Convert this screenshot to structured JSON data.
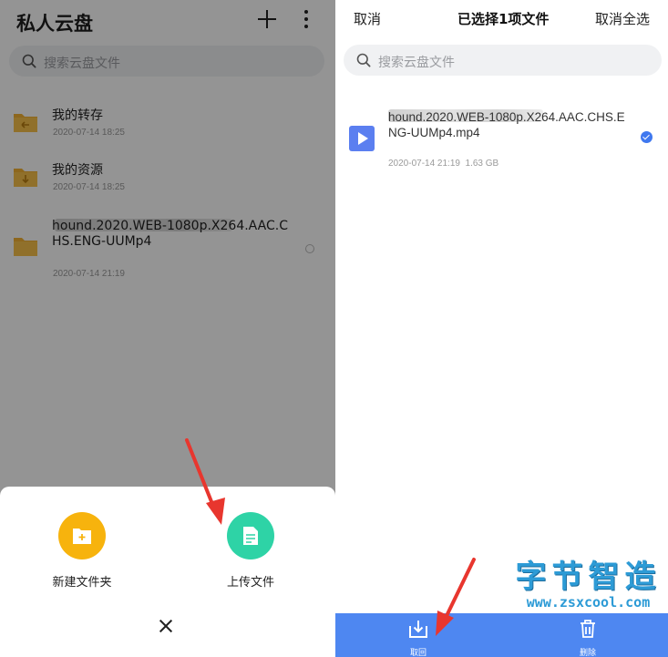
{
  "left": {
    "title": "私人云盘",
    "search_placeholder": "搜索云盘文件",
    "folders": [
      {
        "name": "我的转存",
        "date": "2020-07-14 18:25"
      },
      {
        "name": "我的资源",
        "date": "2020-07-14 18:25"
      },
      {
        "name": "hound.2020.WEB-1080p.X264.AAC.CHS.ENG-UUMp4",
        "date": "2020-07-14 21:19"
      }
    ],
    "sheet": {
      "new_folder_label": "新建文件夹",
      "upload_label": "上传文件"
    },
    "colors": {
      "new_folder": "#f7b30d",
      "upload": "#2ed3a6"
    }
  },
  "right": {
    "cancel_label": "取消",
    "title": "已选择1项文件",
    "cancel_all_label": "取消全选",
    "search_placeholder": "搜索云盘文件",
    "selected_file": {
      "name": "hound.2020.WEB-1080p.X264.AAC.CHS.ENG-UUMp4.mp4",
      "date": "2020-07-14 21:19",
      "size": "1.63 GB"
    },
    "bottom_bar": {
      "retrieve_label": "取回",
      "delete_label": "删除"
    },
    "colors": {
      "bar": "#4e87f1",
      "check": "#3f78ef",
      "video_icon": "#5b7ff0"
    }
  },
  "watermark": {
    "brand": "字节智造",
    "url": "www.zsxcool.com"
  },
  "annotation_color": "#e8362e"
}
